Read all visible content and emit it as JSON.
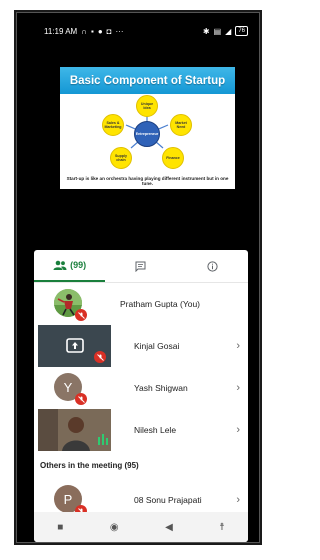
{
  "status_bar": {
    "time": "11:19 AM",
    "battery": "76"
  },
  "slide": {
    "title": "Basic Component of Startup",
    "center_label": "Entrepreneur",
    "nodes": [
      "Unique Idea",
      "Market Need",
      "Finance",
      "Supply chain",
      "Sales & Marketing"
    ],
    "footer": "Start-up is like an orchestra having playing different instrument but in one tune."
  },
  "tabs": [
    {
      "label": "(99)",
      "icon": "people-icon"
    },
    {
      "label": "",
      "icon": "chat-icon"
    },
    {
      "label": "",
      "icon": "info-icon"
    }
  ],
  "participants": [
    {
      "name": "Pratham Gupta (You)",
      "avatar_letter": "",
      "muted": true
    },
    {
      "name": "Kinjal Gosai",
      "avatar_letter": "",
      "muted": true
    },
    {
      "name": "Yash Shigwan",
      "avatar_letter": "Y",
      "muted": true
    },
    {
      "name": "Nilesh Lele",
      "avatar_letter": "",
      "muted": false
    }
  ],
  "others_section": {
    "title": "Others in the meeting (95)"
  },
  "others": [
    {
      "name": "08 Sonu Prajapati",
      "avatar_letter": "P",
      "muted": true
    }
  ],
  "colors": {
    "accent": "#1a7f3c",
    "muted_badge": "#d93025",
    "slide_header": "#1497d4"
  }
}
